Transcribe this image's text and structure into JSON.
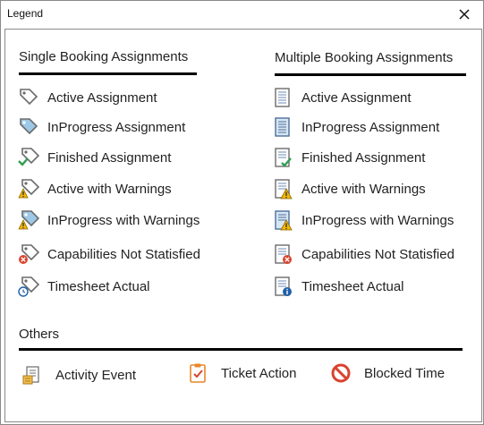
{
  "window": {
    "title": "Legend",
    "close_glyph": "✕"
  },
  "single": {
    "heading": "Single Booking Assignments",
    "items": [
      {
        "label": "Active Assignment",
        "icon": "tag-icon"
      },
      {
        "label": "InProgress Assignment",
        "icon": "tag-filled-icon"
      },
      {
        "label": "Finished Assignment",
        "icon": "tag-check-icon"
      },
      {
        "label": "Active with Warnings",
        "icon": "tag-warning-icon"
      },
      {
        "label": "InProgress with Warnings",
        "icon": "tag-filled-warning-icon"
      },
      {
        "label": "Capabilities Not Statisfied",
        "icon": "tag-error-icon"
      },
      {
        "label": "Timesheet Actual",
        "icon": "tag-clock-icon"
      }
    ]
  },
  "multiple": {
    "heading": "Multiple Booking Assignments",
    "items": [
      {
        "label": "Active Assignment",
        "icon": "document-icon"
      },
      {
        "label": "InProgress Assignment",
        "icon": "document-filled-icon"
      },
      {
        "label": "Finished Assignment",
        "icon": "document-check-icon"
      },
      {
        "label": "Active with Warnings",
        "icon": "document-warning-icon"
      },
      {
        "label": "InProgress with Warnings",
        "icon": "document-filled-warning-icon"
      },
      {
        "label": "Capabilities Not Statisfied",
        "icon": "document-error-icon"
      },
      {
        "label": "Timesheet Actual",
        "icon": "document-info-icon"
      }
    ]
  },
  "others": {
    "heading": "Others",
    "items": [
      {
        "label": "Activity Event",
        "icon": "activity-event-icon"
      },
      {
        "label": "Ticket Action",
        "icon": "clipboard-check-icon"
      },
      {
        "label": "Blocked Time",
        "icon": "blocked-icon"
      }
    ]
  },
  "colors": {
    "tag_fill": "#9ec9e6",
    "tag_stroke": "#6b6b6b",
    "doc_fill": "#d6e6f4",
    "warning": "#f2b705",
    "error": "#d9432f",
    "check": "#2e9e52",
    "info": "#1f5fa8",
    "blocked": "#d9432f",
    "clipboard": "#e8872a"
  }
}
